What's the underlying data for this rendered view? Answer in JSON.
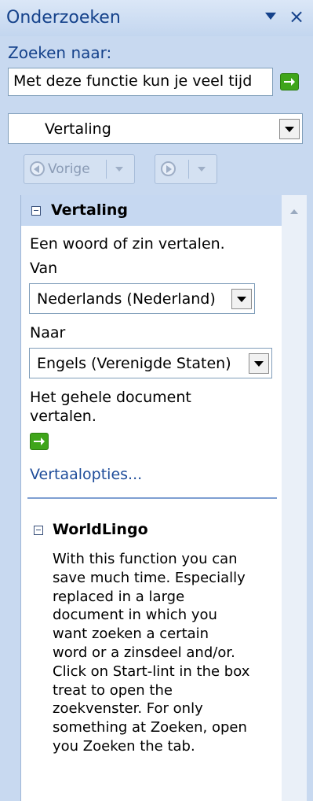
{
  "pane": {
    "title": "Onderzoeken",
    "search_label": "Zoeken naar:",
    "search_value": "Met deze functie kun je veel tijd",
    "service_value": "Vertaling",
    "back_label": "Vorige"
  },
  "translation": {
    "heading": "Vertaling",
    "description": "Een woord of zin vertalen.",
    "from_label": "Van",
    "from_value": "Nederlands (Nederland)",
    "to_label": "Naar",
    "to_value": "Engels (Verenigde Staten)",
    "document_line1": "Het gehele document",
    "document_line2": "vertalen.",
    "options_link": "Vertaalopties..."
  },
  "worldlingo": {
    "heading": "WorldLingo",
    "lines": [
      "With this function you can",
      "save much time. Especially",
      "replaced in a large",
      "document in which you",
      "want zoeken a certain",
      "word or a zinsdeel and/or.",
      "Click on Start-lint in the box",
      "treat to open the",
      "zoekvenster. For only",
      "something at Zoeken, open",
      "you Zoeken the tab."
    ]
  },
  "colors": {
    "title_text": "#15428b",
    "go_button": "#3fa51a",
    "link": "#1f4d9a",
    "section_header": "#c6d8f1"
  },
  "icons": [
    "dropdown-arrow-icon",
    "close-icon",
    "go-arrow-icon",
    "back-arrow-icon",
    "forward-arrow-icon",
    "collapse-icon",
    "scroll-up-icon"
  ]
}
